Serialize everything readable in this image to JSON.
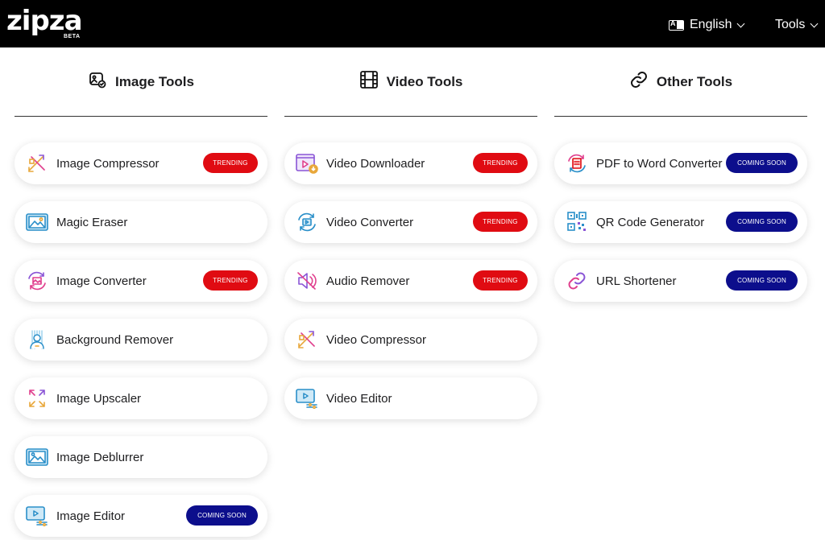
{
  "header": {
    "logo": "zipza",
    "logo_tag": "BETA",
    "language_label": "English",
    "tools_label": "Tools"
  },
  "colors": {
    "trending": "#e00b12",
    "coming_soon": "#0c0e8c",
    "header_bg": "#000000"
  },
  "columns": [
    {
      "title": "Image Tools",
      "icon": "image-tools-icon",
      "items": [
        {
          "label": "Image Compressor",
          "icon": "image-compressor-icon",
          "badge": "TRENDING"
        },
        {
          "label": "Magic Eraser",
          "icon": "magic-eraser-icon",
          "badge": ""
        },
        {
          "label": "Image Converter",
          "icon": "image-converter-icon",
          "badge": "TRENDING"
        },
        {
          "label": "Background Remover",
          "icon": "background-remover-icon",
          "badge": ""
        },
        {
          "label": "Image Upscaler",
          "icon": "image-upscaler-icon",
          "badge": ""
        },
        {
          "label": "Image Deblurrer",
          "icon": "image-deblurrer-icon",
          "badge": ""
        },
        {
          "label": "Image Editor",
          "icon": "image-editor-icon",
          "badge": "COMING SOON"
        }
      ]
    },
    {
      "title": "Video Tools",
      "icon": "film-icon",
      "items": [
        {
          "label": "Video Downloader",
          "icon": "video-downloader-icon",
          "badge": "TRENDING"
        },
        {
          "label": "Video Converter",
          "icon": "video-converter-icon",
          "badge": "TRENDING"
        },
        {
          "label": "Audio Remover",
          "icon": "audio-remover-icon",
          "badge": "TRENDING"
        },
        {
          "label": "Video Compressor",
          "icon": "video-compressor-icon",
          "badge": ""
        },
        {
          "label": "Video Editor",
          "icon": "video-editor-icon",
          "badge": ""
        }
      ]
    },
    {
      "title": "Other Tools",
      "icon": "link-icon",
      "items": [
        {
          "label": "PDF to Word Converter",
          "icon": "pdf-to-word-icon",
          "badge": "COMING SOON"
        },
        {
          "label": "QR Code Generator",
          "icon": "qr-code-icon",
          "badge": "COMING SOON"
        },
        {
          "label": "URL Shortener",
          "icon": "url-shortener-icon",
          "badge": "COMING SOON"
        }
      ]
    }
  ]
}
